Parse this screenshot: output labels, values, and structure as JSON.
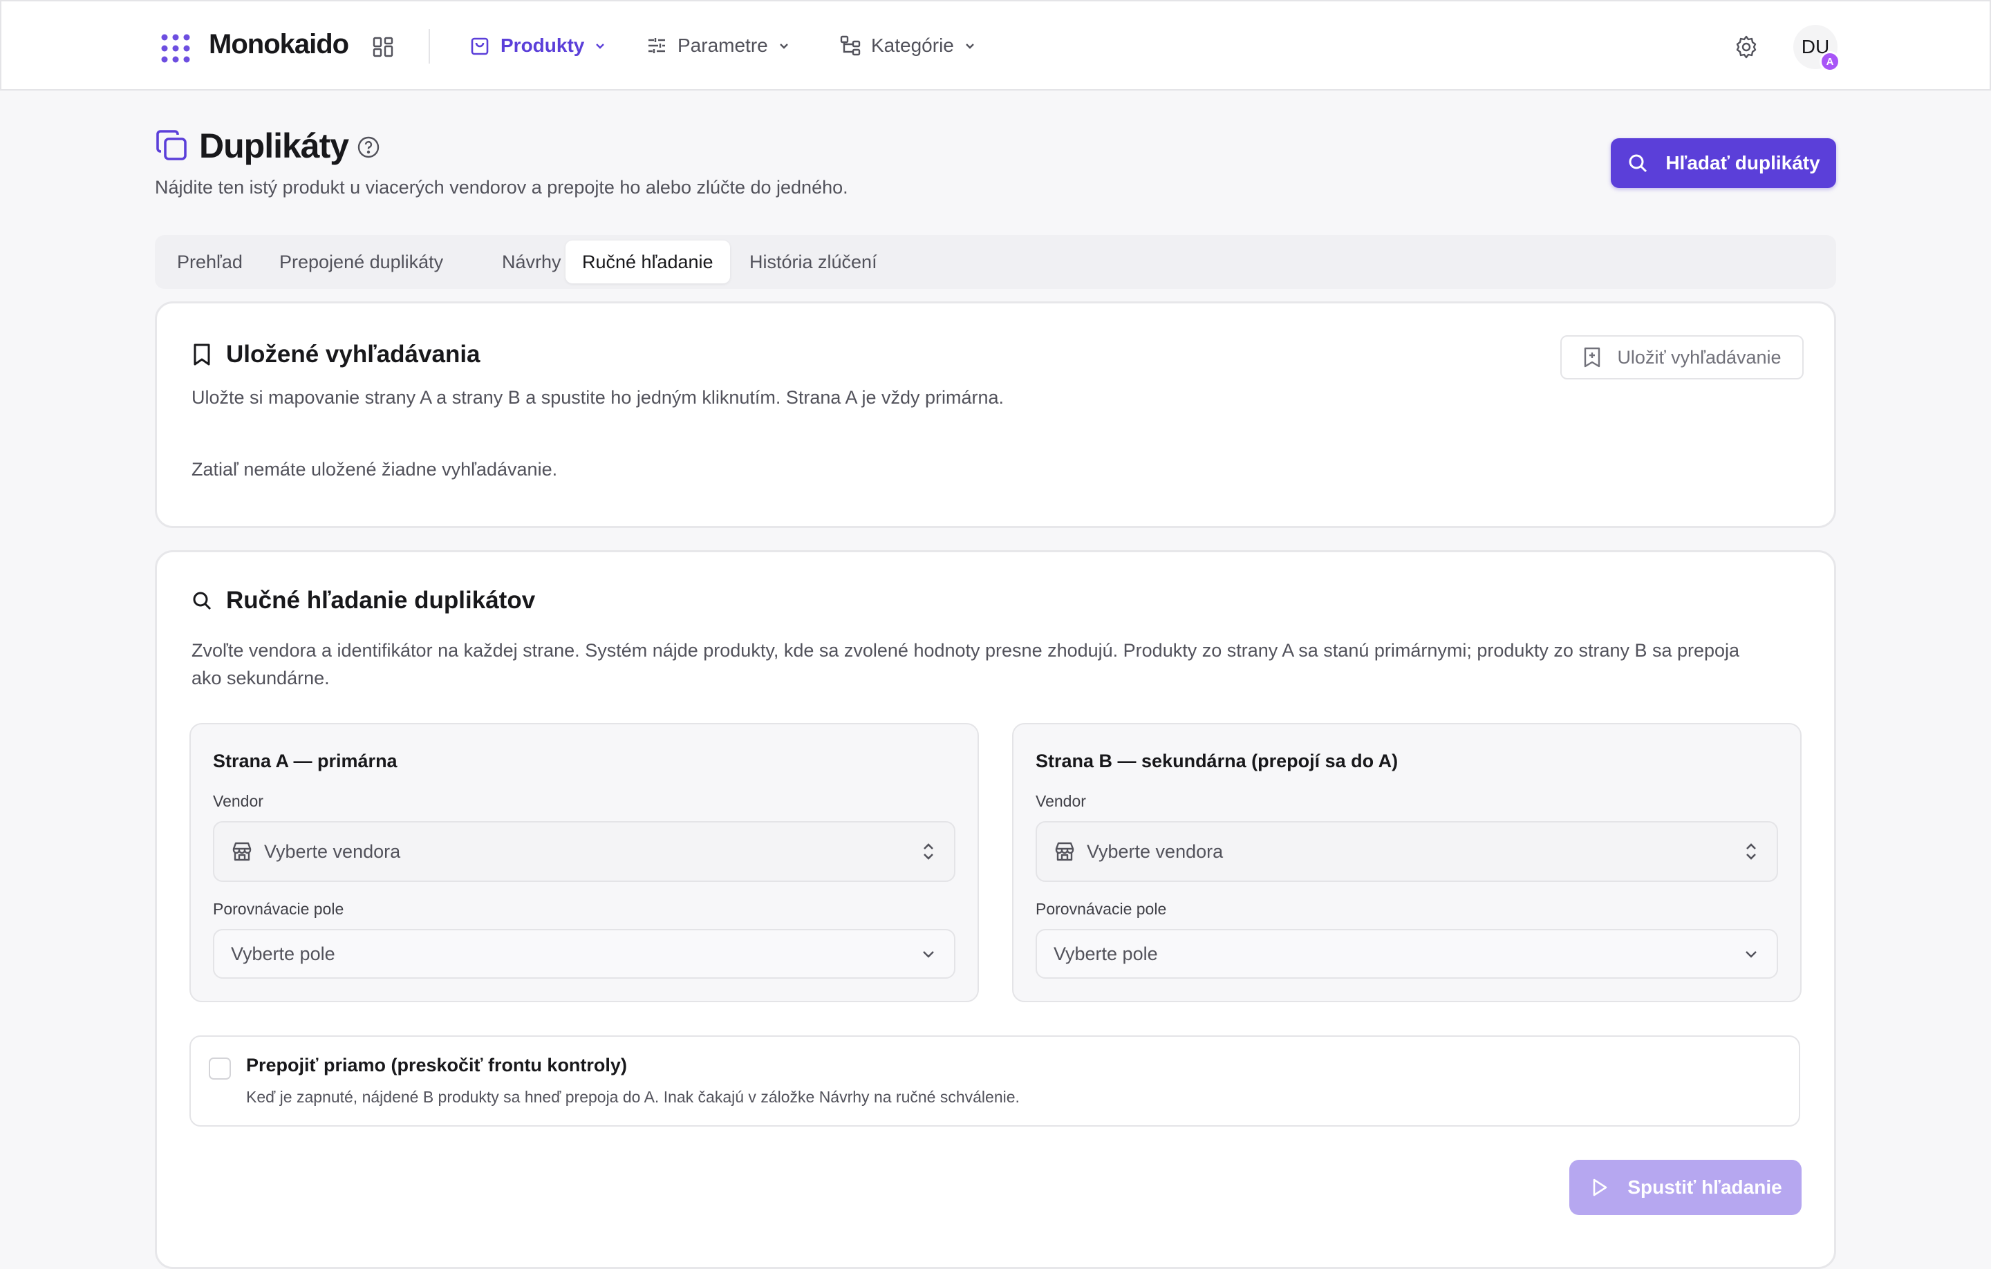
{
  "app": {
    "name": "Monokaido"
  },
  "nav": [
    {
      "label": "Produkty",
      "icon": "bag-icon",
      "active": true
    },
    {
      "label": "Parametre",
      "icon": "sliders-icon",
      "active": false
    },
    {
      "label": "Kategórie",
      "icon": "tree-icon",
      "active": false
    }
  ],
  "user": {
    "initials": "DU",
    "badge": "A"
  },
  "page": {
    "title": "Duplikáty",
    "subtitle": "Nájdite ten istý produkt u viacerých vendorov a prepojte ho alebo zlúčte do jedného.",
    "primary_action": "Hľadať duplikáty"
  },
  "tabs": [
    "Prehľad",
    "Prepojené duplikáty",
    "Návrhy",
    "Ručné hľadanie",
    "História zlúčení"
  ],
  "active_tab": "Ručné hľadanie",
  "saved": {
    "title": "Uložené vyhľadávania",
    "description": "Uložte si mapovanie strany A a strany B a spustite ho jedným kliknutím. Strana A je vždy primárna.",
    "save_button": "Uložiť vyhľadávanie",
    "empty": "Zatiaľ nemáte uložené žiadne vyhľadávanie."
  },
  "manual": {
    "title": "Ručné hľadanie duplikátov",
    "description_line1": "Zvoľte vendora a identifikátor na každej strane. Systém nájde produkty, kde sa zvolené hodnoty presne zhodujú. Produkty zo strany A sa stanú primárnymi; produkty zo strany B sa prepoja",
    "description_line2": "ako sekundárne.",
    "side_a": {
      "title": "Strana A — primárna",
      "vendor_label": "Vendor",
      "vendor_placeholder": "Vyberte vendora",
      "field_label": "Porovnávacie pole",
      "field_placeholder": "Vyberte pole"
    },
    "side_b": {
      "title": "Strana B — sekundárna (prepojí sa do A)",
      "vendor_label": "Vendor",
      "vendor_placeholder": "Vyberte vendora",
      "field_label": "Porovnávacie pole",
      "field_placeholder": "Vyberte pole"
    },
    "direct_link": {
      "checked": false,
      "title": "Prepojiť priamo (preskočiť frontu kontroly)",
      "description": "Keď je zapnuté, nájdené B produkty sa hneď prepoja do A. Inak čakajú v záložke Návrhy na ručné schválenie."
    },
    "run_button": "Spustiť hľadanie"
  },
  "colors": {
    "accent": "#5b3fd9",
    "accent_disabled": "#b6a7f0",
    "badge": "#a855f7"
  }
}
